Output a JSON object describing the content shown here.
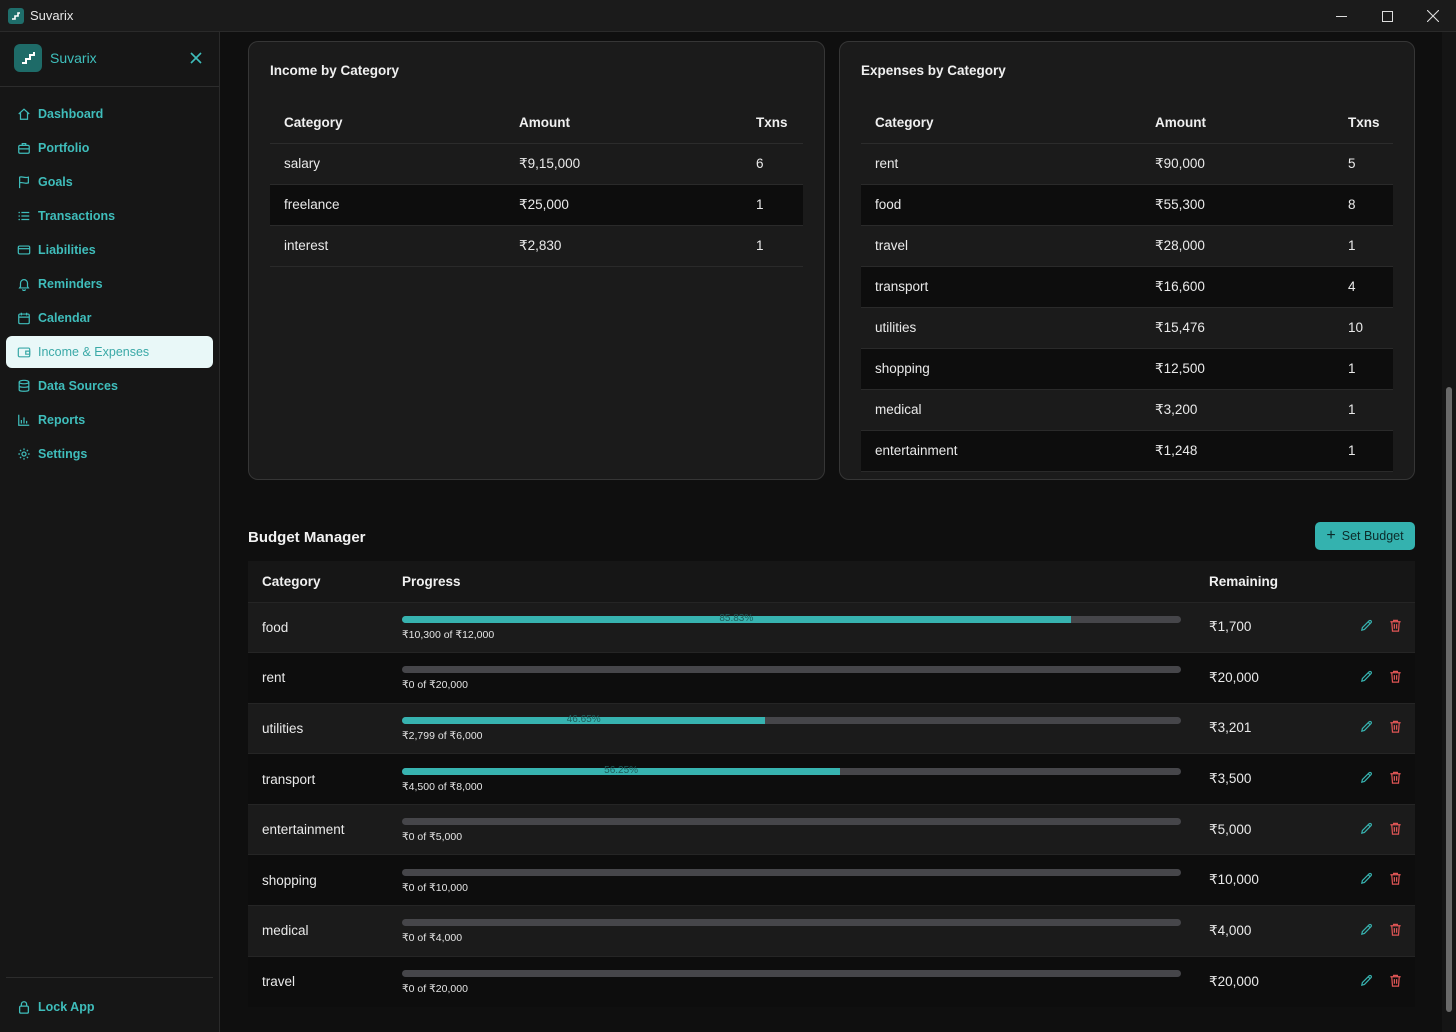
{
  "window": {
    "title": "Suvarix"
  },
  "sidebar": {
    "brand": "Suvarix",
    "items": [
      {
        "label": "Dashboard",
        "icon": "home-icon",
        "name": "sidebar-item-dashboard"
      },
      {
        "label": "Portfolio",
        "icon": "briefcase-icon",
        "name": "sidebar-item-portfolio"
      },
      {
        "label": "Goals",
        "icon": "flag-icon",
        "name": "sidebar-item-goals"
      },
      {
        "label": "Transactions",
        "icon": "list-icon",
        "name": "sidebar-item-transactions"
      },
      {
        "label": "Liabilities",
        "icon": "credit-card-icon",
        "name": "sidebar-item-liabilities"
      },
      {
        "label": "Reminders",
        "icon": "bell-icon",
        "name": "sidebar-item-reminders"
      },
      {
        "label": "Calendar",
        "icon": "calendar-icon",
        "name": "sidebar-item-calendar"
      },
      {
        "label": "Income & Expenses",
        "icon": "wallet-icon",
        "name": "sidebar-item-income-expenses",
        "active": true
      },
      {
        "label": "Data Sources",
        "icon": "database-icon",
        "name": "sidebar-item-data-sources"
      },
      {
        "label": "Reports",
        "icon": "bar-chart-icon",
        "name": "sidebar-item-reports"
      },
      {
        "label": "Settings",
        "icon": "gear-icon",
        "name": "sidebar-item-settings"
      }
    ],
    "lock_label": "Lock App"
  },
  "income": {
    "title": "Income by Category",
    "headers": {
      "category": "Category",
      "amount": "Amount",
      "txns": "Txns"
    },
    "rows": [
      {
        "category": "salary",
        "amount": "₹9,15,000",
        "txns": "6"
      },
      {
        "category": "freelance",
        "amount": "₹25,000",
        "txns": "1"
      },
      {
        "category": "interest",
        "amount": "₹2,830",
        "txns": "1"
      }
    ]
  },
  "expenses": {
    "title": "Expenses by Category",
    "headers": {
      "category": "Category",
      "amount": "Amount",
      "txns": "Txns"
    },
    "rows": [
      {
        "category": "rent",
        "amount": "₹90,000",
        "txns": "5"
      },
      {
        "category": "food",
        "amount": "₹55,300",
        "txns": "8"
      },
      {
        "category": "travel",
        "amount": "₹28,000",
        "txns": "1"
      },
      {
        "category": "transport",
        "amount": "₹16,600",
        "txns": "4"
      },
      {
        "category": "utilities",
        "amount": "₹15,476",
        "txns": "10"
      },
      {
        "category": "shopping",
        "amount": "₹12,500",
        "txns": "1"
      },
      {
        "category": "medical",
        "amount": "₹3,200",
        "txns": "1"
      },
      {
        "category": "entertainment",
        "amount": "₹1,248",
        "txns": "1"
      }
    ]
  },
  "budget": {
    "title": "Budget Manager",
    "set_budget_label": "Set Budget",
    "headers": {
      "category": "Category",
      "progress": "Progress",
      "remaining": "Remaining"
    },
    "rows": [
      {
        "category": "food",
        "percent": 85.83,
        "percent_label": "85.83%",
        "spent_text": "₹10,300 of ₹12,000",
        "remaining": "₹1,700"
      },
      {
        "category": "rent",
        "percent": 0,
        "percent_label": "",
        "spent_text": "₹0 of ₹20,000",
        "remaining": "₹20,000"
      },
      {
        "category": "utilities",
        "percent": 46.65,
        "percent_label": "46.65%",
        "spent_text": "₹2,799 of ₹6,000",
        "remaining": "₹3,201"
      },
      {
        "category": "transport",
        "percent": 56.25,
        "percent_label": "56.25%",
        "spent_text": "₹4,500 of ₹8,000",
        "remaining": "₹3,500"
      },
      {
        "category": "entertainment",
        "percent": 0,
        "percent_label": "",
        "spent_text": "₹0 of ₹5,000",
        "remaining": "₹5,000"
      },
      {
        "category": "shopping",
        "percent": 0,
        "percent_label": "",
        "spent_text": "₹0 of ₹10,000",
        "remaining": "₹10,000"
      },
      {
        "category": "medical",
        "percent": 0,
        "percent_label": "",
        "spent_text": "₹0 of ₹4,000",
        "remaining": "₹4,000"
      },
      {
        "category": "travel",
        "percent": 0,
        "percent_label": "",
        "spent_text": "₹0 of ₹20,000",
        "remaining": "₹20,000"
      }
    ]
  },
  "colors": {
    "accent": "#37b3b0",
    "danger": "#e05555",
    "background": "#0f0f0f",
    "card": "#1b1b1b"
  }
}
